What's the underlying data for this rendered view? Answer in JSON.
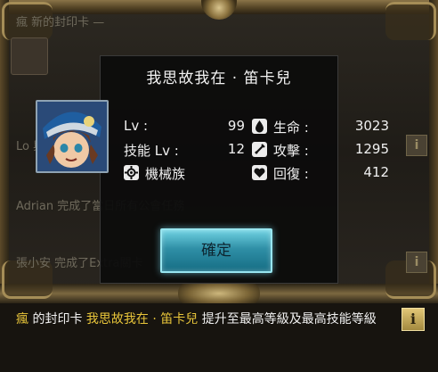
{
  "background_feed": {
    "line1": "瘋     新的封印卡 —",
    "line2": "Lo           與不棄",
    "line3": "Adrian  完成了當日所有公會任務",
    "line4": "張小安  完成了Extra關卡"
  },
  "modal": {
    "title": "我思故我在 · 笛卡兒",
    "stats": {
      "lv_label": "Lv :",
      "lv_value": "99",
      "skill_label": "技能 Lv :",
      "skill_value": "12",
      "race": "機械族",
      "hp_label": "生命 :",
      "hp_value": "3023",
      "atk_label": "攻擊 :",
      "atk_value": "1295",
      "rec_label": "回復 :",
      "rec_value": "412"
    },
    "confirm_label": "確定"
  },
  "notice": {
    "user": "瘋",
    "part1": " 的封印卡 ",
    "card": "我思故我在 · 笛卡兒",
    "part2": " 提升至最高等級及最高技能等級",
    "info_label": "i"
  },
  "icons": {
    "hp": "drop-icon",
    "atk": "sword-icon",
    "rec": "heart-icon",
    "race": "machine-race-icon"
  },
  "colors": {
    "highlight": "#e8c53a",
    "confirm_button": "#2f8fa6"
  }
}
